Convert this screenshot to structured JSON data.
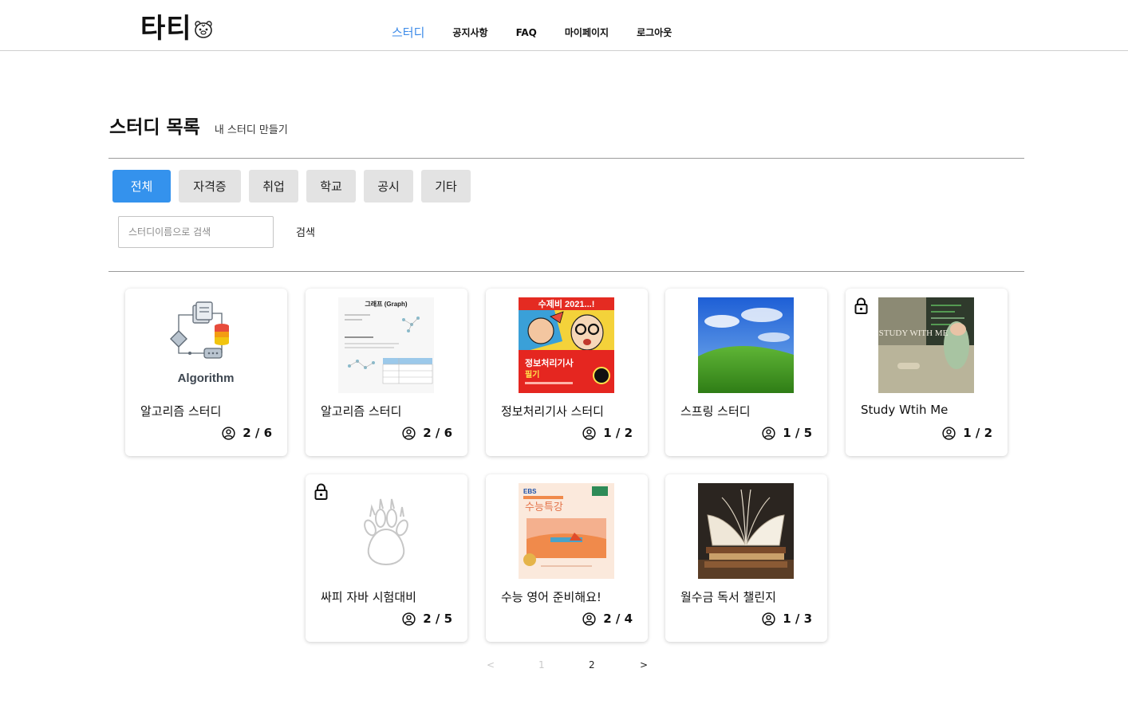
{
  "header": {
    "logo_text": "타티",
    "logo_icon": "tiger-face-icon",
    "nav": [
      "스터디",
      "공지사항",
      "FAQ",
      "마이페이지",
      "로그아웃"
    ],
    "active_nav": "스터디"
  },
  "page": {
    "title": "스터디 목록",
    "create_link": "내 스터디 만들기"
  },
  "tabs": [
    "전체",
    "자격증",
    "취업",
    "학교",
    "공시",
    "기타"
  ],
  "active_tab": "전체",
  "search": {
    "placeholder": "스터디이름으로 검색",
    "button_label": "검색"
  },
  "studies": [
    {
      "title": "알고리즘 스터디",
      "members": "2 / 6",
      "image": "algorithm-diagram",
      "image_caption": "Algorithm",
      "locked": false
    },
    {
      "title": "알고리즘 스터디",
      "members": "2 / 6",
      "image": "graph-document",
      "image_caption": "그래프 (Graph)",
      "locked": false
    },
    {
      "title": "정보처리기사 스터디",
      "members": "1 / 2",
      "image": "exam-book-cover",
      "image_caption": "수제비 2021...!",
      "locked": false
    },
    {
      "title": "스프링 스터디",
      "members": "1 / 5",
      "image": "green-hill-landscape",
      "image_caption": "",
      "locked": false
    },
    {
      "title": "Study Wtih Me",
      "members": "1 / 2",
      "image": "study-with-me-photo",
      "image_caption": "STUDY WITH ME",
      "locked": true
    },
    {
      "title": "싸피 자바 시험대비",
      "members": "2 / 5",
      "image": "paw-print",
      "image_caption": "",
      "locked": true
    },
    {
      "title": "수능 영어 준비해요!",
      "members": "2 / 4",
      "image": "ebs-book-cover",
      "image_caption": "수능특강",
      "locked": false
    },
    {
      "title": "월수금 독서 챌린지",
      "members": "1 / 3",
      "image": "open-books-photo",
      "image_caption": "",
      "locked": false
    }
  ],
  "pagination": {
    "prev": "<",
    "pages": [
      "1",
      "2"
    ],
    "current": "2",
    "next": ">"
  },
  "colors": {
    "accent": "#3492ed",
    "nav_active": "#3b8ae8",
    "tab_bg": "#e3e3e3"
  }
}
